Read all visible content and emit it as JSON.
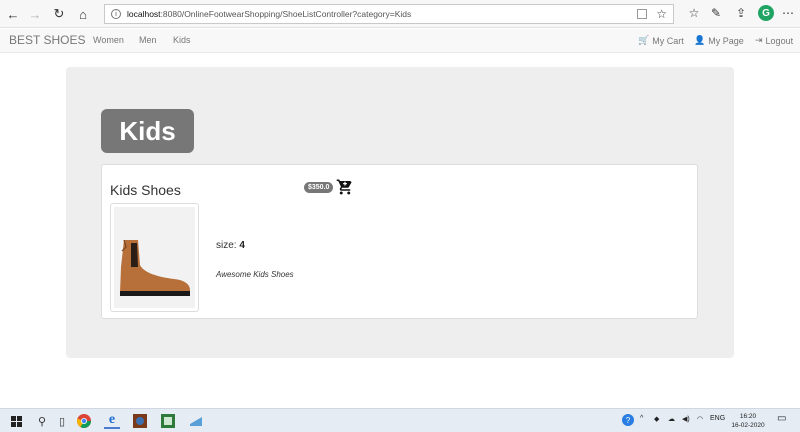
{
  "browser": {
    "url_host": "localhost",
    "url_path": ":8080/OnlineFootwearShopping/ShoeListController?category=Kids",
    "profile_initial": "G"
  },
  "navbar": {
    "brand": "BEST SHOES",
    "links": [
      "Women",
      "Men",
      "Kids"
    ],
    "cart_label": "My Cart",
    "mypage_label": "My Page",
    "logout_label": "Logout"
  },
  "category": {
    "title": "Kids"
  },
  "product": {
    "name": "Kids Shoes",
    "price": "$350.0",
    "size_label": "size:",
    "size_value": "4",
    "description": "Awesome Kids Shoes"
  },
  "taskbar": {
    "language": "ENG",
    "time": "16:20",
    "date": "16-02-2020"
  },
  "colors": {
    "navbar_bg": "#f8f8f8",
    "jumbotron_bg": "#eeeeee",
    "badge_bg": "#777777",
    "shoe_tan": "#b8703a"
  }
}
